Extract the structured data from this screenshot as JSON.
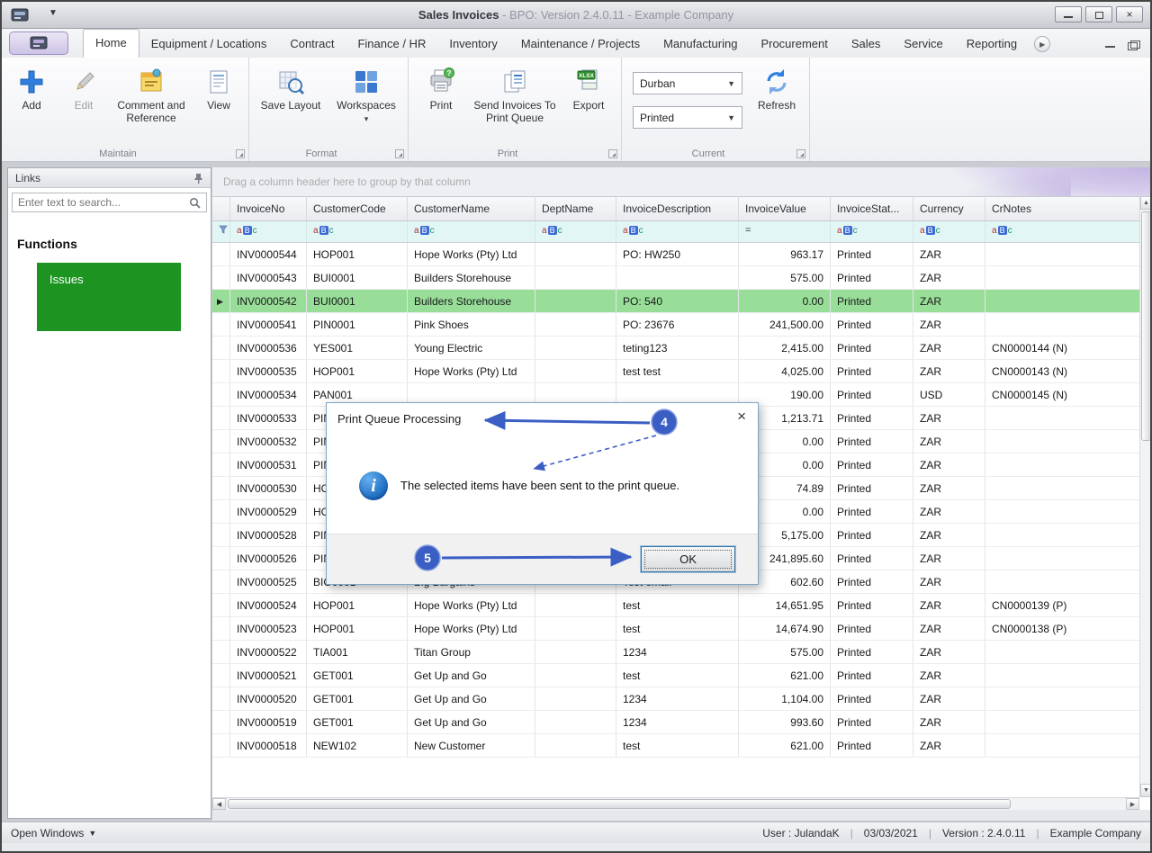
{
  "window": {
    "title_bold": "Sales Invoices",
    "title_rest": " - BPO: Version 2.4.0.11 - Example Company"
  },
  "icons": {
    "dropdown": "▾",
    "menu_down": "▼",
    "row_pointer": "▶",
    "scroll_left": "◀",
    "scroll_right": "▶",
    "scroll_up": "▲",
    "scroll_down": "▼",
    "minimize": "–",
    "close": "×",
    "ribbon_play": "▶",
    "info": "i",
    "print_badge": "?",
    "export_badge": "XLSX"
  },
  "ribbon": {
    "tabs": [
      {
        "label": "Home",
        "active": true
      },
      {
        "label": "Equipment / Locations",
        "active": false
      },
      {
        "label": "Contract",
        "active": false
      },
      {
        "label": "Finance / HR",
        "active": false
      },
      {
        "label": "Inventory",
        "active": false
      },
      {
        "label": "Maintenance / Projects",
        "active": false
      },
      {
        "label": "Manufacturing",
        "active": false
      },
      {
        "label": "Procurement",
        "active": false
      },
      {
        "label": "Sales",
        "active": false
      },
      {
        "label": "Service",
        "active": false
      },
      {
        "label": "Reporting",
        "active": false
      }
    ],
    "maintain": {
      "label": "Maintain",
      "add": "Add",
      "edit": "Edit",
      "comment": "Comment and Reference",
      "view": "View"
    },
    "format": {
      "label": "Format",
      "save_layout": "Save Layout",
      "workspaces": "Workspaces"
    },
    "print_group": {
      "label": "Print",
      "print": "Print",
      "send": "Send Invoices To Print Queue",
      "export": "Export"
    },
    "current": {
      "label": "Current",
      "site": "Durban",
      "status": "Printed",
      "refresh": "Refresh"
    }
  },
  "sidebar": {
    "title": "Links",
    "search_placeholder": "Enter text to search...",
    "functions_heading": "Functions",
    "items": [
      {
        "label": "Issues"
      }
    ]
  },
  "grid": {
    "group_hint": "Drag a column header here to group by that column",
    "columns": [
      "InvoiceNo",
      "CustomerCode",
      "CustomerName",
      "DeptName",
      "InvoiceDescription",
      "InvoiceValue",
      "InvoiceStat...",
      "Currency",
      "CrNotes"
    ],
    "filters": [
      "aBc",
      "aBc",
      "aBc",
      "aBc",
      "aBc",
      "=",
      "aBc",
      "aBc",
      "aBc"
    ],
    "rows": [
      {
        "selected": false,
        "cells": [
          "INV0000544",
          "HOP001",
          "Hope Works (Pty) Ltd",
          "",
          "PO: HW250",
          "963.17",
          "Printed",
          "ZAR",
          ""
        ]
      },
      {
        "selected": false,
        "cells": [
          "INV0000543",
          "BUI0001",
          "Builders Storehouse",
          "",
          "",
          "575.00",
          "Printed",
          "ZAR",
          ""
        ]
      },
      {
        "selected": true,
        "cells": [
          "INV0000542",
          "BUI0001",
          "Builders Storehouse",
          "",
          "PO: 540",
          "0.00",
          "Printed",
          "ZAR",
          ""
        ]
      },
      {
        "selected": false,
        "cells": [
          "INV0000541",
          "PIN0001",
          "Pink Shoes",
          "",
          "PO: 23676",
          "241,500.00",
          "Printed",
          "ZAR",
          ""
        ]
      },
      {
        "selected": false,
        "cells": [
          "INV0000536",
          "YES001",
          "Young Electric",
          "",
          "teting123",
          "2,415.00",
          "Printed",
          "ZAR",
          "CN0000144 (N)"
        ]
      },
      {
        "selected": false,
        "cells": [
          "INV0000535",
          "HOP001",
          "Hope Works (Pty) Ltd",
          "",
          "test test",
          "4,025.00",
          "Printed",
          "ZAR",
          "CN0000143 (N)"
        ]
      },
      {
        "selected": false,
        "cells": [
          "INV0000534",
          "PAN001",
          "",
          "",
          "",
          "190.00",
          "Printed",
          "USD",
          "CN0000145 (N)"
        ]
      },
      {
        "selected": false,
        "cells": [
          "INV0000533",
          "PIN",
          "",
          "",
          "",
          "1,213.71",
          "Printed",
          "ZAR",
          ""
        ]
      },
      {
        "selected": false,
        "cells": [
          "INV0000532",
          "PIN",
          "",
          "",
          "",
          "0.00",
          "Printed",
          "ZAR",
          ""
        ]
      },
      {
        "selected": false,
        "cells": [
          "INV0000531",
          "PIN",
          "",
          "",
          "",
          "0.00",
          "Printed",
          "ZAR",
          ""
        ]
      },
      {
        "selected": false,
        "cells": [
          "INV0000530",
          "HO",
          "",
          "",
          "",
          "74.89",
          "Printed",
          "ZAR",
          ""
        ]
      },
      {
        "selected": false,
        "cells": [
          "INV0000529",
          "HO",
          "",
          "",
          "",
          "0.00",
          "Printed",
          "ZAR",
          ""
        ]
      },
      {
        "selected": false,
        "cells": [
          "INV0000528",
          "PIN",
          "",
          "",
          "",
          "5,175.00",
          "Printed",
          "ZAR",
          ""
        ]
      },
      {
        "selected": false,
        "cells": [
          "INV0000526",
          "PIN",
          "",
          "",
          "",
          "241,895.60",
          "Printed",
          "ZAR",
          ""
        ]
      },
      {
        "selected": false,
        "cells": [
          "INV0000525",
          "BIG0001",
          "Big Bargains",
          "",
          "Test email",
          "602.60",
          "Printed",
          "ZAR",
          ""
        ]
      },
      {
        "selected": false,
        "cells": [
          "INV0000524",
          "HOP001",
          "Hope Works (Pty) Ltd",
          "",
          "test",
          "14,651.95",
          "Printed",
          "ZAR",
          "CN0000139 (P)"
        ]
      },
      {
        "selected": false,
        "cells": [
          "INV0000523",
          "HOP001",
          "Hope Works (Pty) Ltd",
          "",
          "test",
          "14,674.90",
          "Printed",
          "ZAR",
          "CN0000138 (P)"
        ]
      },
      {
        "selected": false,
        "cells": [
          "INV0000522",
          "TIA001",
          "Titan Group",
          "",
          "1234",
          "575.00",
          "Printed",
          "ZAR",
          ""
        ]
      },
      {
        "selected": false,
        "cells": [
          "INV0000521",
          "GET001",
          "Get Up and Go",
          "",
          "test",
          "621.00",
          "Printed",
          "ZAR",
          ""
        ]
      },
      {
        "selected": false,
        "cells": [
          "INV0000520",
          "GET001",
          "Get Up and Go",
          "",
          "1234",
          "1,104.00",
          "Printed",
          "ZAR",
          ""
        ]
      },
      {
        "selected": false,
        "cells": [
          "INV0000519",
          "GET001",
          "Get Up and Go",
          "",
          "1234",
          "993.60",
          "Printed",
          "ZAR",
          ""
        ]
      },
      {
        "selected": false,
        "cells": [
          "INV0000518",
          "NEW102",
          "New Customer",
          "",
          "test",
          "621.00",
          "Printed",
          "ZAR",
          ""
        ]
      }
    ]
  },
  "dialog": {
    "title": "Print Queue Processing",
    "message": "The selected items have been sent to the print queue.",
    "ok_label": "OK"
  },
  "annotations": {
    "step4": "4",
    "step5": "5",
    "color": "#3a5ec4"
  },
  "statusbar": {
    "open_windows": "Open Windows",
    "separator": "|",
    "segments": [
      "User : JulandaK",
      "03/03/2021",
      "Version : 2.4.0.11",
      "Example Company"
    ]
  }
}
